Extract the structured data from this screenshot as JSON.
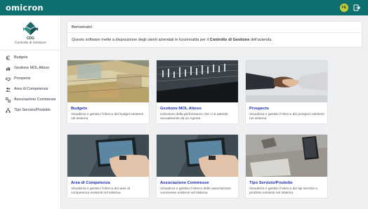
{
  "header": {
    "logo_text": "omicron",
    "avatar_initials": "FE",
    "logout_icon": "logout-icon"
  },
  "sidebar": {
    "brand_short": "CDG",
    "brand_sub": "Controllo di Gestione",
    "items": [
      {
        "label": "Budgets",
        "icon": "euro-icon"
      },
      {
        "label": "Gestione MOL Atteso",
        "icon": "chart-icon"
      },
      {
        "label": "Prospects",
        "icon": "handshake-icon"
      },
      {
        "label": "Area di Competenza",
        "icon": "users-icon"
      },
      {
        "label": "Associazione Commesse",
        "icon": "link-icon"
      },
      {
        "label": "Tipo Servizio/Prodotto",
        "icon": "network-icon"
      }
    ]
  },
  "welcome": {
    "title": "Benvenuto!",
    "text_before": "Questo software mette a disposizione degli utenti aziendali le funzionalità per il ",
    "text_bold": "Controllo di Gestione",
    "text_after": " dell'azienda."
  },
  "cards": [
    {
      "title": "Budgets",
      "desc": "Visualizza e gestisci l'elenco dei budget esistenti nel sistema"
    },
    {
      "title": "Gestione MOL Atteso",
      "desc": "Indicatore della performance che ci si attende annualmente da un Agente"
    },
    {
      "title": "Prospects",
      "desc": "Visualizza e gestisci l'elenco dei prospect esistenti nel sistema"
    },
    {
      "title": "Area di Competenza",
      "desc": "Visualizza e gestisci l'elenco dei aree di competenza esistenti nel sistema"
    },
    {
      "title": "Associazione Commesse",
      "desc": "Visualizza e gestisci l'elenco delle associazione commesse esistenti nel sistema"
    },
    {
      "title": "Tipo Servizio/Prodotto",
      "desc": "Visualizza e gestisci l'elenco dei tipi servizio e prodotto esistenti nel sistema"
    }
  ],
  "colors": {
    "header_bg": "#0e6f6f",
    "card_title": "#1d2fb0",
    "avatar_bg": "#c6cf3a"
  }
}
